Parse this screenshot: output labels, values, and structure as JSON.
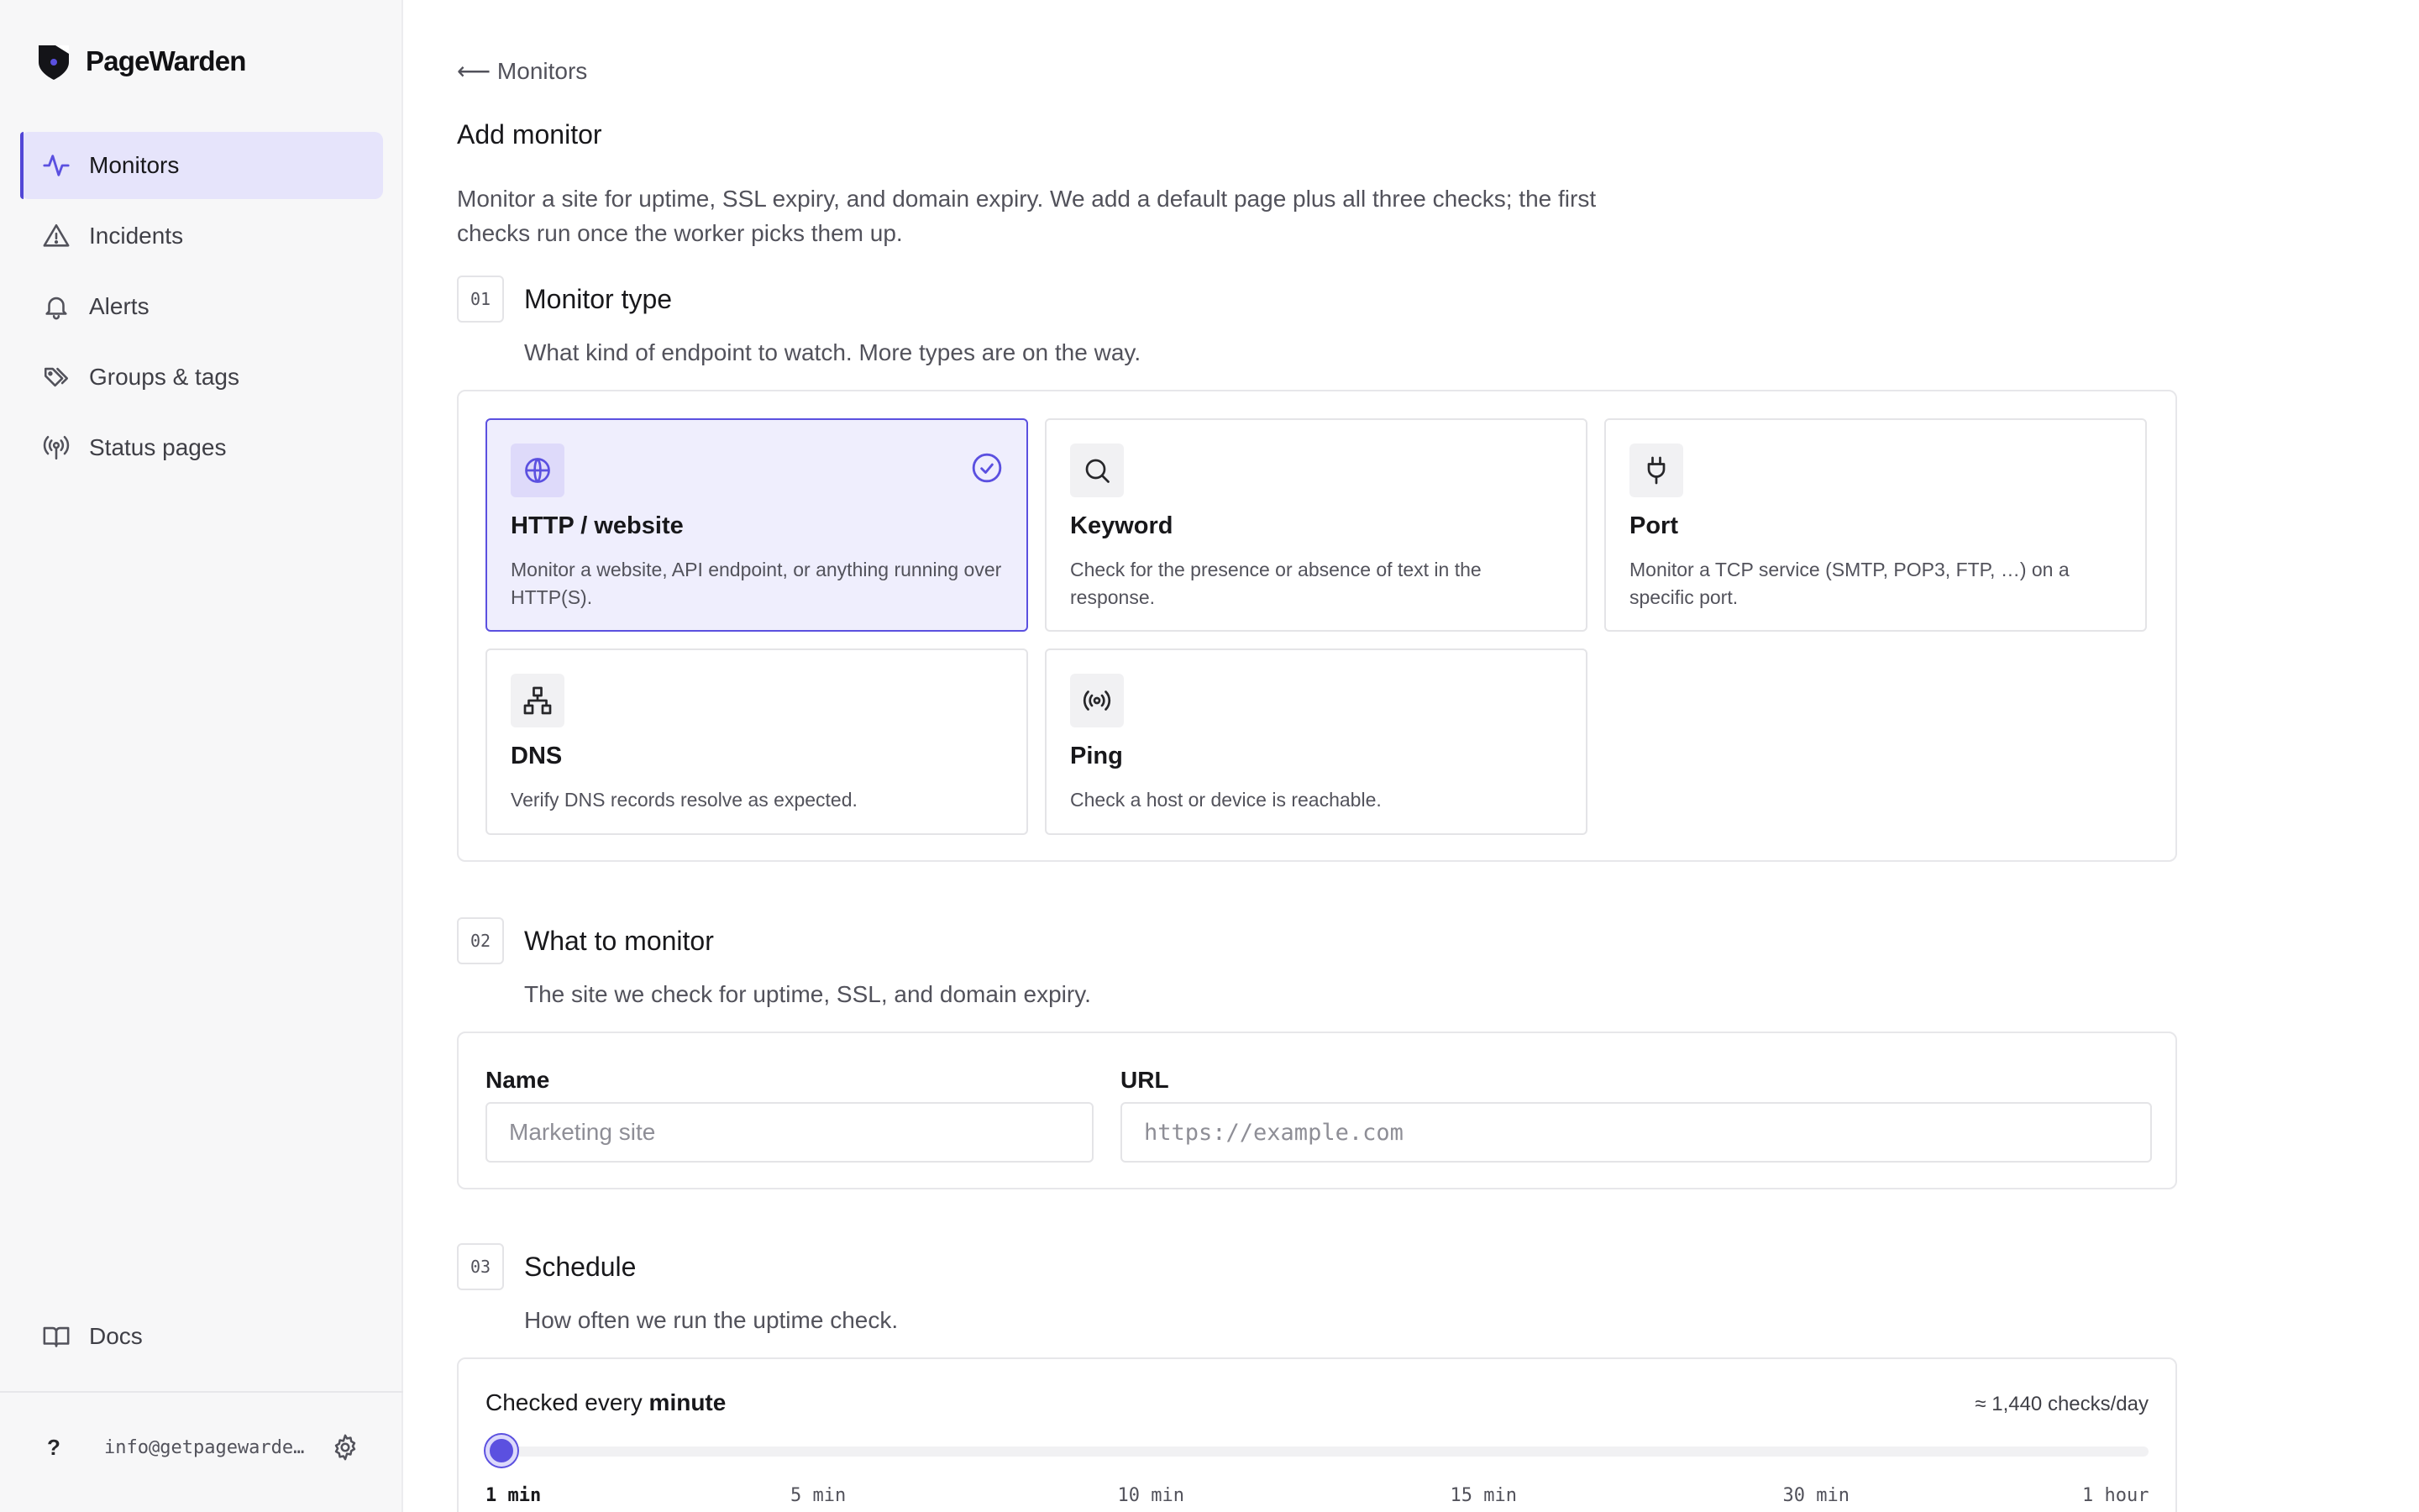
{
  "app": {
    "name": "PageWarden"
  },
  "sidebar": {
    "items": [
      {
        "label": "Monitors",
        "icon": "activity-icon",
        "active": true
      },
      {
        "label": "Incidents",
        "icon": "warning-triangle-icon"
      },
      {
        "label": "Alerts",
        "icon": "bell-icon"
      },
      {
        "label": "Groups & tags",
        "icon": "tags-icon"
      },
      {
        "label": "Status pages",
        "icon": "broadcast-icon"
      }
    ],
    "docs_label": "Docs",
    "help_glyph": "?",
    "user_email": "info@getpagewarden…"
  },
  "page": {
    "back_label": "⟵ Monitors",
    "title": "Add monitor",
    "description": "Monitor a site for uptime, SSL expiry, and domain expiry. We add a default page plus all three checks; the first checks run once the worker picks them up."
  },
  "steps": {
    "type": {
      "num": "01",
      "title": "Monitor type",
      "subtitle": "What kind of endpoint to watch. More types are on the way.",
      "cards": [
        {
          "title": "HTTP / website",
          "desc": "Monitor a website, API endpoint, or anything running over HTTP(S).",
          "icon": "globe-icon",
          "selected": true
        },
        {
          "title": "Keyword",
          "desc": "Check for the presence or absence of text in the response.",
          "icon": "search-icon"
        },
        {
          "title": "Port",
          "desc": "Monitor a TCP service (SMTP, POP3, FTP, …) on a specific port.",
          "icon": "plug-icon"
        },
        {
          "title": "DNS",
          "desc": "Verify DNS records resolve as expected.",
          "icon": "network-icon"
        },
        {
          "title": "Ping",
          "desc": "Check a host or device is reachable.",
          "icon": "signal-icon"
        }
      ]
    },
    "target": {
      "num": "02",
      "title": "What to monitor",
      "subtitle": "The site we check for uptime, SSL, and domain expiry.",
      "name_label": "Name",
      "name_placeholder": "Marketing site",
      "name_value": "",
      "url_label": "URL",
      "url_placeholder": "https://example.com",
      "url_value": ""
    },
    "schedule": {
      "num": "03",
      "title": "Schedule",
      "subtitle": "How often we run the uptime check.",
      "label_prefix": "Checked every ",
      "label_value": "minute",
      "rate": "≈ 1,440 checks/day",
      "selected_index": 0,
      "ticks": [
        "1 min",
        "5 min",
        "10 min",
        "15 min",
        "30 min",
        "1 hour"
      ]
    }
  },
  "colors": {
    "accent": "#5b50e0",
    "accent_soft": "#efeefd",
    "nav_active_bg": "#e6e4fb"
  }
}
